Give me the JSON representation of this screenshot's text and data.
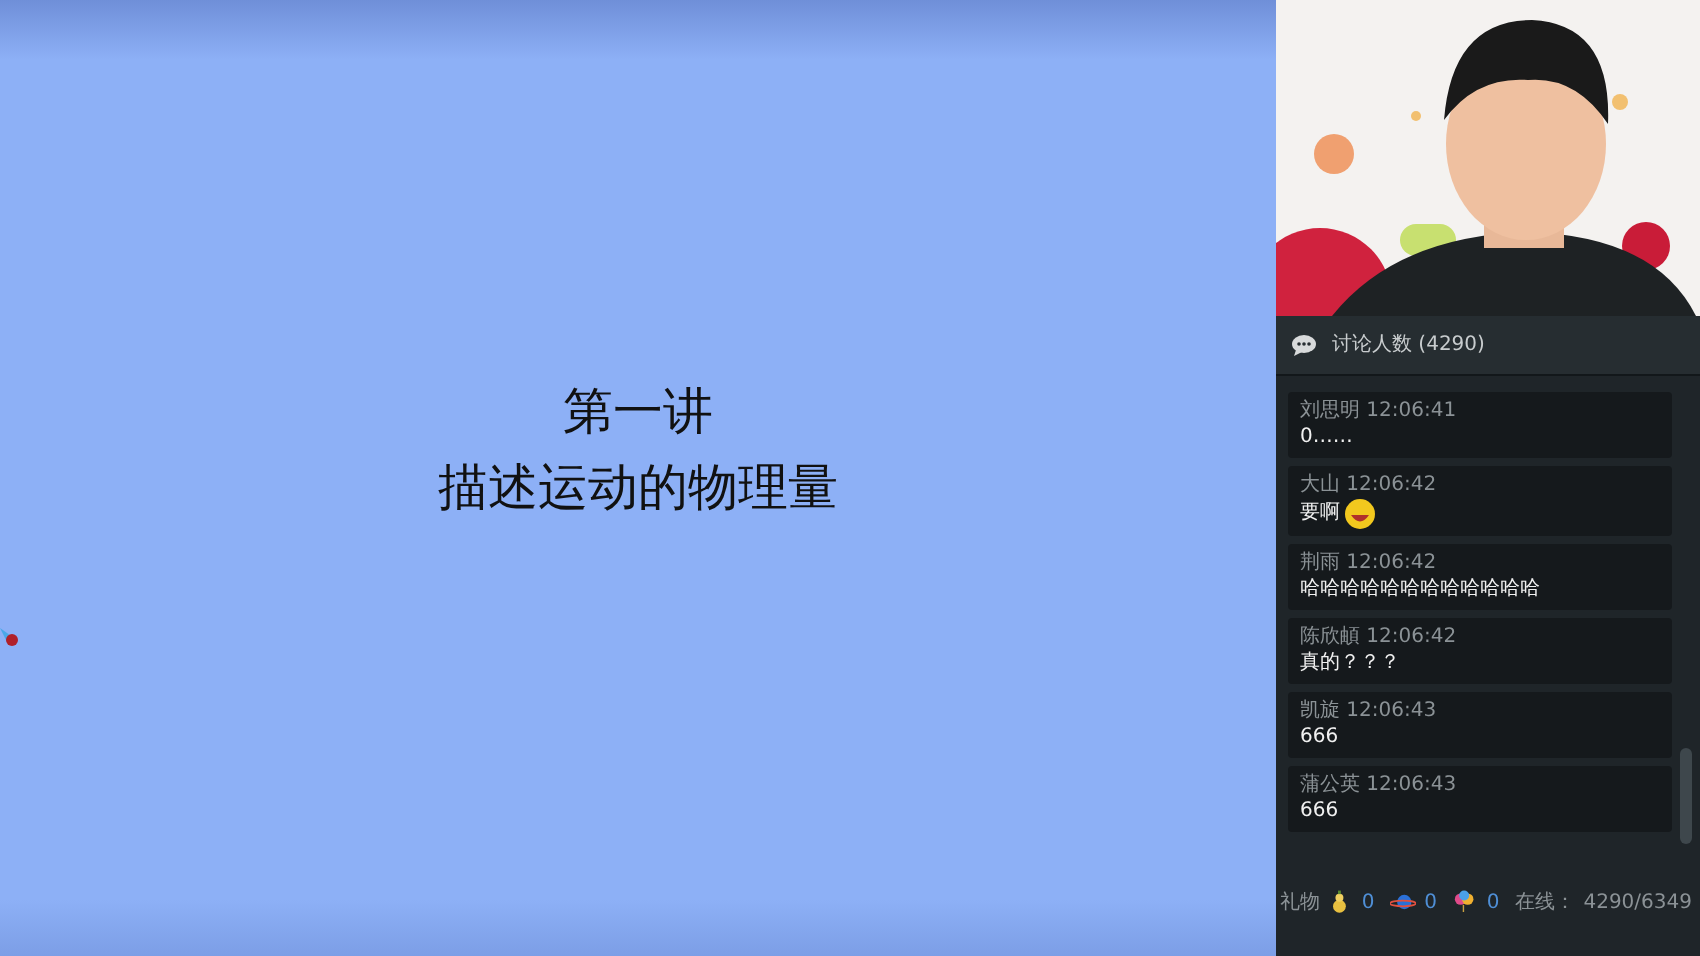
{
  "slide": {
    "title_lines": [
      "第一讲",
      "描述运动的物理量"
    ]
  },
  "chat": {
    "header": "讨论人数 (4290)",
    "messages": [
      {
        "name": "刘思明",
        "time": "12:06:41",
        "text": "0……",
        "emoji": false
      },
      {
        "name": "大山",
        "time": "12:06:42",
        "text": "要啊",
        "emoji": true
      },
      {
        "name": "荆雨",
        "time": "12:06:42",
        "text": "哈哈哈哈哈哈哈哈哈哈哈哈",
        "emoji": false
      },
      {
        "name": "陈欣頔",
        "time": "12:06:42",
        "text": "真的？？？",
        "emoji": false
      },
      {
        "name": "凯旋",
        "time": "12:06:43",
        "text": "666",
        "emoji": false
      },
      {
        "name": "蒲公英",
        "time": "12:06:43",
        "text": "666",
        "emoji": false
      }
    ]
  },
  "footer": {
    "gifts_label": "礼物",
    "gifts": [
      {
        "kind": "gourd",
        "count": "0"
      },
      {
        "kind": "planet",
        "count": "0"
      },
      {
        "kind": "balloon",
        "count": "0"
      }
    ],
    "online_label": "在线：",
    "online": "4290/6349"
  }
}
